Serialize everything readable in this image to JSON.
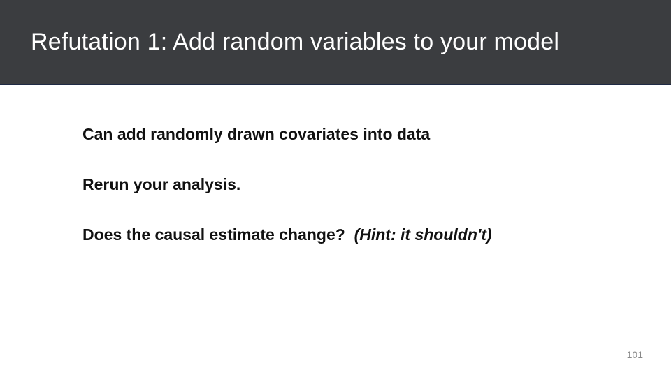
{
  "header": {
    "title": "Refutation 1: Add random variables to your model"
  },
  "body": {
    "points": [
      "Can add randomly drawn covariates into data",
      "Rerun your analysis."
    ],
    "question": "Does the causal estimate change?",
    "hint": "(Hint: it shouldn't)"
  },
  "footer": {
    "page": "101"
  }
}
